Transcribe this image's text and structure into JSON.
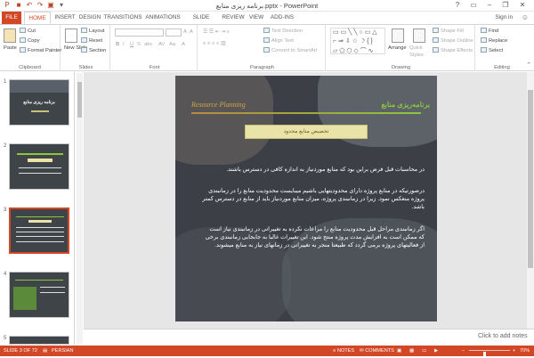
{
  "app": {
    "title": "برنامه ریزی منابع.pptx - PowerPoint",
    "window_controls": [
      "?",
      "▭",
      "–",
      "❐",
      "✕"
    ],
    "quick_access": [
      "save-icon",
      "undo-icon",
      "redo-icon",
      "start-icon",
      "customize-icon"
    ]
  },
  "tabs": {
    "file": "FILE",
    "items": [
      "HOME",
      "INSERT",
      "DESIGN",
      "TRANSITIONS",
      "ANIMATIONS",
      "SLIDE SHOW",
      "REVIEW",
      "VIEW",
      "ADD-INS"
    ],
    "active": "HOME",
    "sign_in": "Sign in"
  },
  "ribbon": {
    "clipboard": {
      "label": "Clipboard",
      "paste": "Paste",
      "cut": "Cut",
      "copy": "Copy",
      "format_painter": "Format Painter"
    },
    "slides": {
      "label": "Slides",
      "new_slide": "New Slide",
      "layout": "Layout",
      "reset": "Reset",
      "section": "Section"
    },
    "font": {
      "label": "Font"
    },
    "paragraph": {
      "label": "Paragraph",
      "text_direction": "Text Direction",
      "align_text": "Align Text",
      "convert": "Convert to SmartArt"
    },
    "drawing": {
      "label": "Drawing",
      "arrange": "Arrange",
      "quick_styles": "Quick Styles",
      "shape_fill": "Shape Fill",
      "shape_outline": "Shape Outline",
      "shape_effects": "Shape Effects"
    },
    "editing": {
      "label": "Editing",
      "find": "Find",
      "replace": "Replace",
      "select": "Select"
    }
  },
  "thumbnails": [
    {
      "num": "1",
      "title": "برنامه ریزی منابع",
      "selected": false
    },
    {
      "num": "2",
      "title": "",
      "selected": false
    },
    {
      "num": "3",
      "title": "",
      "selected": true
    },
    {
      "num": "4",
      "title": "",
      "selected": false
    },
    {
      "num": "5",
      "title": "",
      "selected": false
    }
  ],
  "slide": {
    "title_fa": "برنامه‌ریزی منابع",
    "title_en": "Resource Planning",
    "subtitle": "تخصیص منابع محدود",
    "paragraphs": [
      "در محاسبات قبل فرض براین بود که منابع موردنیاز به اندازه کافی در دسترس باشند.",
      "درصورتیکه در منابع پروژه دارای محدودیتهایی باشیم میبایست محدودیت منابع را در زمانبندی پروژه منعکس نمود. زیرا در زمانبندی پروژه، میزان منابع موردنیاز باید از منابع در دسترس کمتر باشد.",
      "اگر زمانبندی مراحل قبل محدودیت منابع را مراعات نکرده به تغییراتی در زمانبندی نیاز است که ممکن است به افزایش مدت پروژه منتج شود. این تغییرات غالبا به جابجایی زمانبندی برخی از فعالیتهای پروژه برمی گردد که طبیعتا منجر به تغییراتی در زمانهای نیاز به منابع میشوند."
    ]
  },
  "notes": {
    "placeholder": "Click to add notes"
  },
  "status": {
    "slide_info": "SLIDE 3 OF 72",
    "language": "PERSIAN",
    "notes": "NOTES",
    "comments": "COMMENTS",
    "zoom": "70%",
    "zoom_level": 0.7
  },
  "colors": {
    "accent": "#d24726",
    "slide_bg": "#3c4046",
    "title_green": "#8cc63f",
    "title_gold": "#d8a54a",
    "subtitle_box": "#e9e3a8"
  }
}
